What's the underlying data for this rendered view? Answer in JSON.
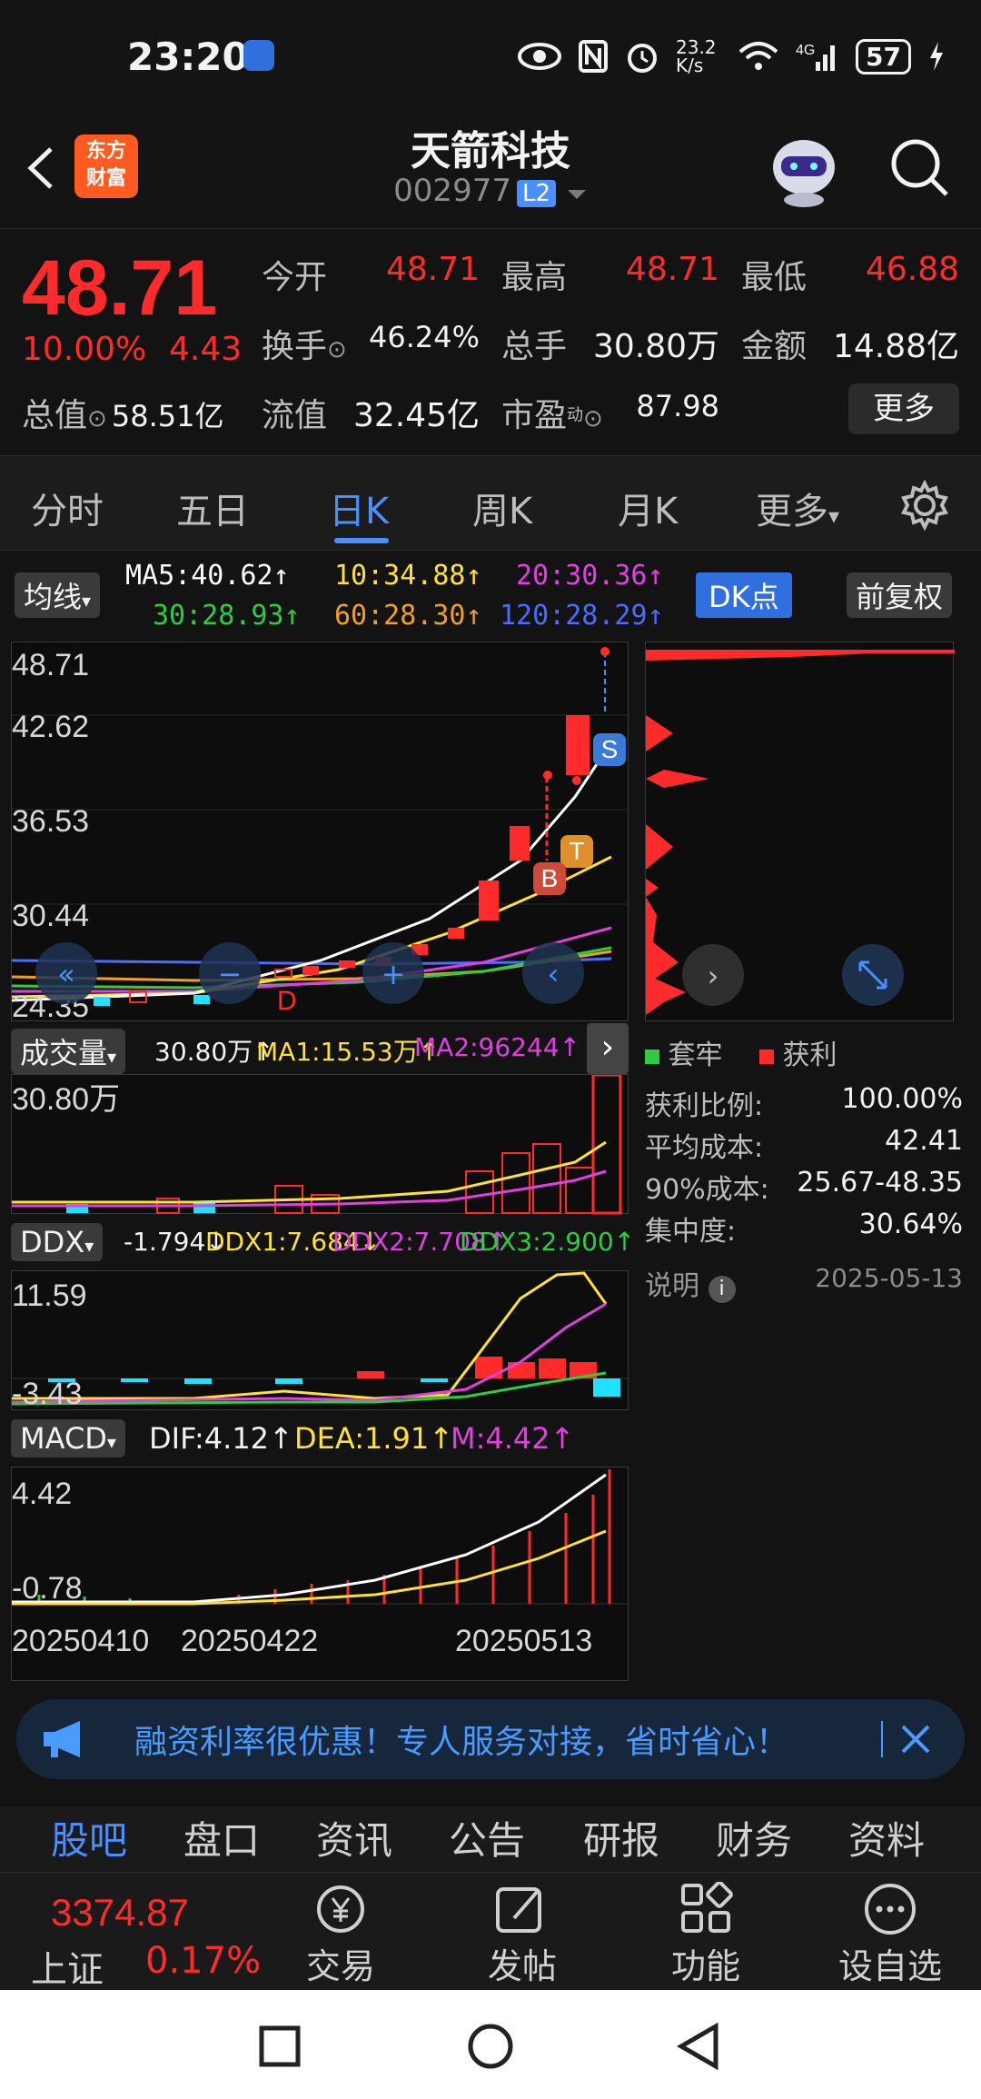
{
  "status_bar": {
    "time": "23:20",
    "speed": "23.2 K/s",
    "battery": "57"
  },
  "header": {
    "title": "天箭科技",
    "code": "002977",
    "level_badge": "L2",
    "logo_text_1": "东方",
    "logo_text_2": "财富"
  },
  "quote": {
    "price": "48.71",
    "change_pct": "10.00%",
    "change": "4.43",
    "open_label": "今开",
    "open": "48.71",
    "high_label": "最高",
    "high": "48.71",
    "low_label": "最低",
    "low": "46.88",
    "turnover_label": "换手",
    "turnover": "46.24%",
    "volume_label": "总手",
    "volume": "30.80万",
    "amount_label": "金额",
    "amount": "14.88亿",
    "mktcap_label": "总值",
    "mktcap": "58.51亿",
    "float_label": "流值",
    "float": "32.45亿",
    "pe_label": "市盈",
    "pe_sup": "动",
    "pe": "87.98",
    "more": "更多"
  },
  "period_tabs": [
    "分时",
    "五日",
    "日K",
    "周K",
    "月K",
    "更多"
  ],
  "active_period": "日K",
  "ma": {
    "selector": "均线",
    "ma5": "MA5:40.62↑",
    "ma10": "10:34.88↑",
    "ma20": "20:30.36↑",
    "ma30": "30:28.93↑",
    "ma60": "60:28.30↑",
    "ma120": "120:28.29↑",
    "dk_button": "DK点",
    "adjust_button": "前复权"
  },
  "kline": {
    "y_labels": [
      "48.71",
      "42.62",
      "36.53",
      "30.44",
      "24.35"
    ],
    "markers": {
      "sell": "S",
      "buy": "B",
      "t": "T",
      "d": "D"
    }
  },
  "volume": {
    "selector": "成交量",
    "value": "30.80万↑",
    "ma1": "MA1:15.53万↑",
    "ma2": "MA2:96244↑",
    "y_top": "30.80万"
  },
  "ddx": {
    "selector": "DDX",
    "value": "-1.794↓",
    "ddx1": "DDX1:7.684↓",
    "ddx2": "DDX2:7.708↑",
    "ddx3": "DDX3:2.900↑",
    "y_top": "11.59",
    "y_bottom": "-3.43"
  },
  "macd": {
    "selector": "MACD",
    "dif": "DIF:4.12↑",
    "dea": "DEA:1.91↑",
    "m": "M:4.42↑",
    "y_top": "4.42",
    "y_bottom": "-0.78"
  },
  "x_dates": [
    "20250410",
    "20250422",
    "20250513"
  ],
  "chip": {
    "legend_trapped": "套牢",
    "legend_profit": "获利",
    "rows": [
      {
        "label": "获利比例:",
        "value": "100.00%"
      },
      {
        "label": "平均成本:",
        "value": "42.41"
      },
      {
        "label": "90%成本:",
        "value": "25.67-48.35"
      },
      {
        "label": "集中度:",
        "value": "30.64%"
      }
    ],
    "note_label": "说明",
    "date": "2025-05-13"
  },
  "banner": {
    "text": "融资利率很优惠！专人服务对接，省时省心！"
  },
  "bottom_tabs": [
    "股吧",
    "盘口",
    "资讯",
    "公告",
    "研报",
    "财务",
    "资料"
  ],
  "bottom_bar": {
    "index_value": "3374.87",
    "index_name": "上证",
    "index_change": "0.17%",
    "items": [
      "交易",
      "发帖",
      "功能",
      "设自选"
    ]
  },
  "colors": {
    "up": "#ff2b2b",
    "accent": "#4a8fff",
    "ma5": "#ffffff",
    "ma10": "#ffe135",
    "ma20": "#e040e0",
    "ma30": "#2ecc40",
    "ma60": "#f0a020",
    "ma120": "#4a6cff",
    "ddx_down": "#22e0ff"
  }
}
